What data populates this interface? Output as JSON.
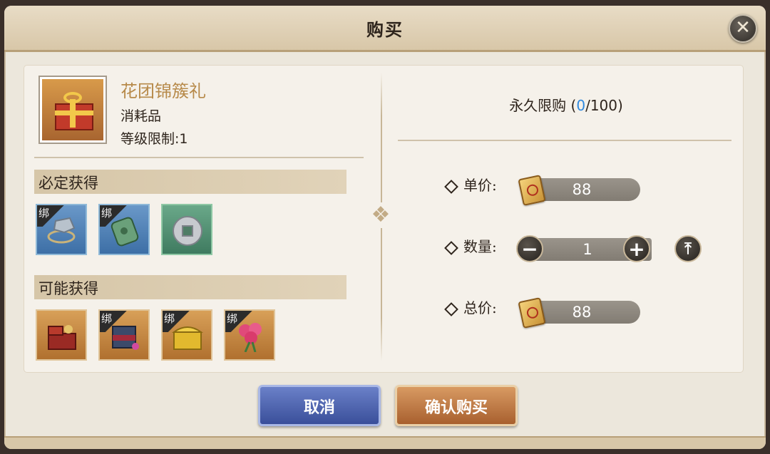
{
  "dialog": {
    "title": "购买",
    "close_icon": "close-icon"
  },
  "item": {
    "name": "花团锦簇礼",
    "type": "消耗品",
    "level_limit": "等级限制:1",
    "icon": "gift-box-icon"
  },
  "sections": {
    "guaranteed": {
      "label": "必定获得",
      "items": [
        {
          "icon": "ore-rope-icon",
          "bound": true,
          "bind_label": "绑"
        },
        {
          "icon": "jade-pendant-icon",
          "bound": true,
          "bind_label": "绑"
        },
        {
          "icon": "silver-coin-icon",
          "bound": false
        }
      ]
    },
    "possible": {
      "label": "可能获得",
      "items": [
        {
          "icon": "treasure-box-icon",
          "bound": false
        },
        {
          "icon": "jewelry-chest-icon",
          "bound": true,
          "bind_label": "绑"
        },
        {
          "icon": "gold-chest-icon",
          "bound": true,
          "bind_label": "绑"
        },
        {
          "icon": "rose-bouquet-icon",
          "bound": true,
          "bind_label": "绑"
        }
      ]
    }
  },
  "purchase": {
    "limit_prefix": "永久限购 (",
    "limit_bought": "0",
    "limit_sep": "/100)",
    "unit_price_label": "单价:",
    "unit_price": "88",
    "quantity_label": "数量:",
    "quantity": "1",
    "total_label": "总价:",
    "total_price": "88",
    "currency_icon": "gold-scroll-icon"
  },
  "buttons": {
    "cancel": "取消",
    "confirm": "确认购买"
  },
  "colors": {
    "accent_blue": "#2f8ae0",
    "item_name": "#b78a4a"
  }
}
